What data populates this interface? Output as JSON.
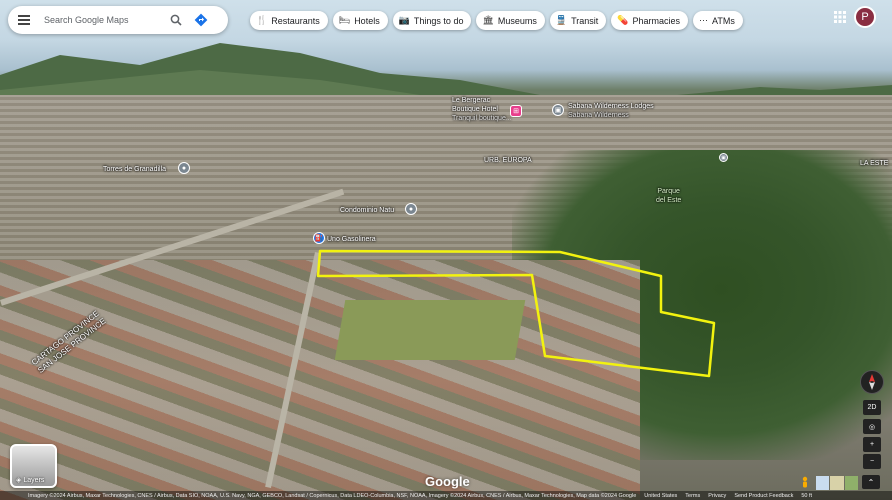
{
  "search": {
    "placeholder": "Search Google Maps"
  },
  "chips": [
    {
      "label": "Restaurants",
      "icon": "fork-knife-icon",
      "glyph": "🍴"
    },
    {
      "label": "Hotels",
      "icon": "bed-icon",
      "glyph": "🛏"
    },
    {
      "label": "Things to do",
      "icon": "camera-icon",
      "glyph": "📷"
    },
    {
      "label": "Museums",
      "icon": "museum-icon",
      "glyph": "🏛"
    },
    {
      "label": "Transit",
      "icon": "train-icon",
      "glyph": "🚆"
    },
    {
      "label": "Pharmacies",
      "icon": "pharmacy-icon",
      "glyph": "💊"
    },
    {
      "label": "ATMs",
      "icon": "atm-icon",
      "glyph": "⋯"
    }
  ],
  "account": {
    "initial": "P",
    "color": "#8a2e42"
  },
  "places": {
    "bergerac": "Le Bergerac\nBoutique Hotel",
    "bergerac_sub": "Tranquil boutique...",
    "sabana": "Sabana Wilderness Lodges",
    "sabana_sub": "Sabana Wilderness",
    "urb_europa": "URB. EUROPA",
    "torres": "Torres de Granadilla",
    "condominio": "Condominio Natu",
    "parque": "Parque\ndel Este",
    "la_este": "LA ESTE",
    "gasolinera": "Uno Gasolinera"
  },
  "road_label": {
    "line1": "CARTAGO PROVINCE",
    "line2": "SAN JOSE PROVINCE"
  },
  "layers": {
    "label": "Layers"
  },
  "logo": {
    "text": "Google"
  },
  "footer": {
    "attribution": "Imagery ©2024 Airbus, Maxar Technologies, CNES / Airbus, Data SIO, NOAA, U.S. Navy, NGA, GEBCO, Landsat / Copernicus, Data LDEO-Columbia, NSF, NOAA, Imagery ©2024 Airbus, CNES / Airbus, Maxar Technologies, Map data ©2024 Google",
    "links": [
      "United States",
      "Terms",
      "Privacy",
      "Send Product Feedback"
    ],
    "scale": "50 ft"
  },
  "controls": {
    "mode": "2D",
    "zoom_in": "+",
    "zoom_out": "−",
    "expand": "⌃"
  },
  "colors": {
    "plot_outline": "#f2f20f",
    "accent_blue": "#1a73e8",
    "pin_pink": "#e83e8c"
  }
}
